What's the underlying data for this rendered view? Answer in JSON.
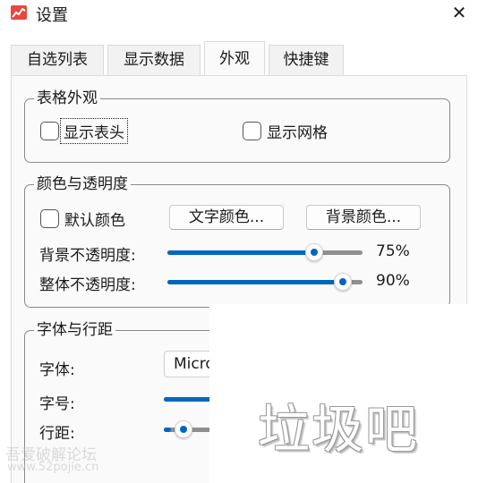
{
  "window": {
    "title": "设置",
    "close_glyph": "✕",
    "app_icon": "chart-icon",
    "accent_color": "#0067c0"
  },
  "tabs": [
    {
      "label": "自选列表",
      "active": false
    },
    {
      "label": "显示数据",
      "active": false
    },
    {
      "label": "外观",
      "active": true
    },
    {
      "label": "快捷键",
      "active": false
    }
  ],
  "table_appearance": {
    "title": "表格外观",
    "show_header": {
      "label": "显示表头",
      "checked": false
    },
    "show_grid": {
      "label": "显示网格",
      "checked": false
    }
  },
  "color_opacity": {
    "title": "颜色与透明度",
    "default_color": {
      "label": "默认颜色",
      "checked": false
    },
    "text_color_button": "文字颜色...",
    "bg_color_button": "背景颜色...",
    "bg_opacity": {
      "label": "背景不透明度:",
      "value": 75,
      "display": "75%"
    },
    "overall_opacity": {
      "label": "整体不透明度:",
      "value": 90,
      "display": "90%"
    }
  },
  "font_spacing": {
    "title": "字体与行距",
    "font": {
      "label": "字体:",
      "value": "Micro"
    },
    "font_size": {
      "label": "字号:",
      "fraction": 0.5
    },
    "line_spacing": {
      "label": "行距:",
      "fraction": 0.2
    }
  },
  "overlay": {
    "text": "垃圾吧"
  },
  "watermark": {
    "line1": "吾爱破解论坛",
    "line2": "www.52pojie.cn"
  }
}
